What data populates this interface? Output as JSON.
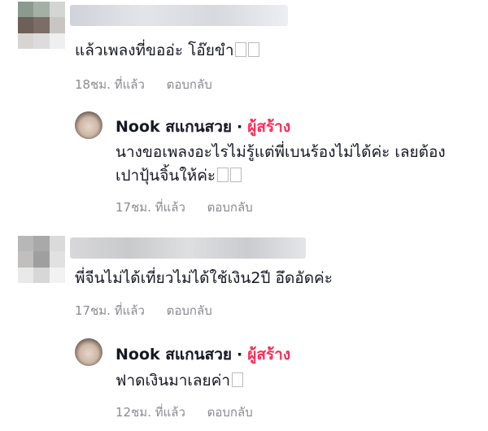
{
  "comments": [
    {
      "text": "แล้วเพลงที่ขออ่ะ โอ๊ยขำ",
      "time": "18ชม. ที่แล้ว",
      "reply_label": "ตอบกลับ",
      "reply": {
        "author": "Nook สแกนสวย",
        "role": "ผู้สร้าง",
        "lines": [
          "นางขอเพลงอะไรไม่รู้แต่พี่เบนร้องไม่ได้ค่ะ เลยต้อง",
          "เปาปุ้นจิ้นให้ค่ะ"
        ],
        "time": "17ชม. ที่แล้ว",
        "reply_label": "ตอบกลับ"
      }
    },
    {
      "text": "พี่จีนไม่ได้เที่ยวไม่ได้ใช้เงิน2ปี อึดอัดค่ะ",
      "time": "17ชม. ที่แล้ว",
      "reply_label": "ตอบกลับ",
      "reply": {
        "author": "Nook สแกนสวย",
        "role": "ผู้สร้าง",
        "lines": [
          "ฟาดเงินมาเลยค่า"
        ],
        "time": "12ชม. ที่แล้ว",
        "reply_label": "ตอบกลับ"
      }
    }
  ],
  "separator": "·",
  "colors": {
    "creator": "#fe2c55",
    "meta": "#8a8b91"
  }
}
